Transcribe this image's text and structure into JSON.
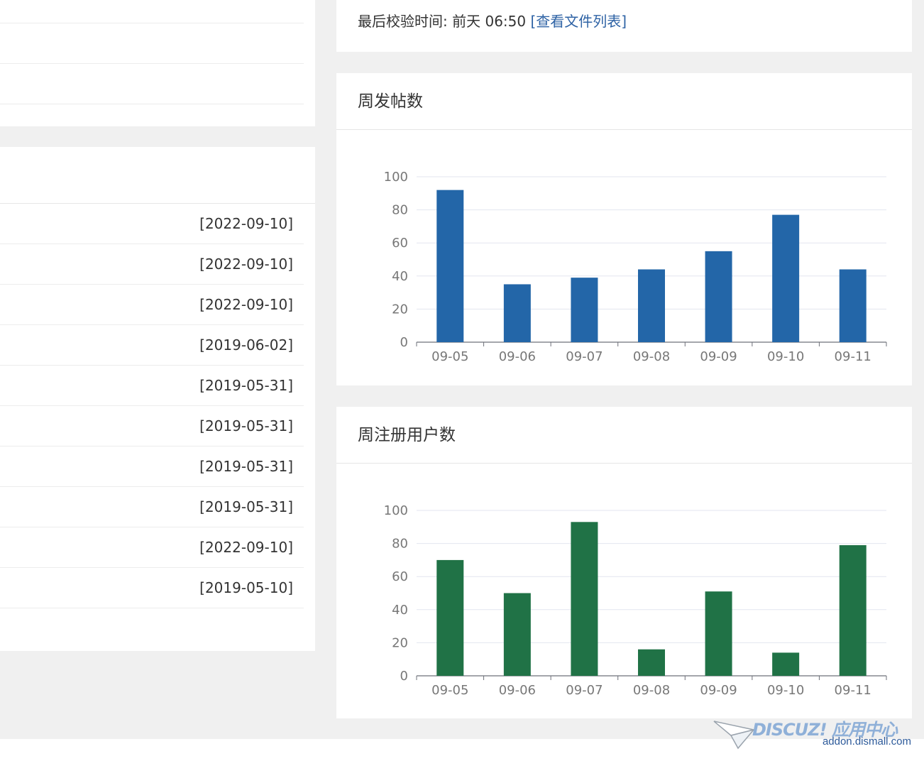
{
  "verify": {
    "label": "最后校验时间:",
    "time": "前天 06:50",
    "link": "[查看文件列表]"
  },
  "news": {
    "dates": [
      "[2022-09-10]",
      "[2022-09-10]",
      "[2022-09-10]",
      "[2019-06-02]",
      "[2019-05-31]",
      "[2019-05-31]",
      "[2019-05-31]",
      "[2019-05-31]",
      "[2022-09-10]",
      "[2019-05-10]"
    ]
  },
  "charts": {
    "posts": {
      "title": "周发帖数"
    },
    "users": {
      "title": "周注册用户数"
    }
  },
  "colors": {
    "posts_bar": "#2366a8",
    "users_bar": "#207246",
    "link": "#2f63a5",
    "grid": "#e3e6ef"
  },
  "chart_data": [
    {
      "type": "bar",
      "title": "周发帖数",
      "categories": [
        "09-05",
        "09-06",
        "09-07",
        "09-08",
        "09-09",
        "09-10",
        "09-11"
      ],
      "values": [
        92,
        35,
        39,
        44,
        55,
        77,
        44
      ],
      "ylim": [
        0,
        100
      ],
      "yticks": [
        0,
        20,
        40,
        60,
        80,
        100
      ],
      "grid": true,
      "color": "#2366a8"
    },
    {
      "type": "bar",
      "title": "周注册用户数",
      "categories": [
        "09-05",
        "09-06",
        "09-07",
        "09-08",
        "09-09",
        "09-10",
        "09-11"
      ],
      "values": [
        70,
        50,
        93,
        16,
        51,
        14,
        79
      ],
      "ylim": [
        0,
        100
      ],
      "yticks": [
        0,
        20,
        40,
        60,
        80,
        100
      ],
      "grid": true,
      "color": "#207246"
    }
  ],
  "watermark": {
    "brand": "DISCUZ! 应用中心",
    "site": "addon.dismall.com"
  }
}
